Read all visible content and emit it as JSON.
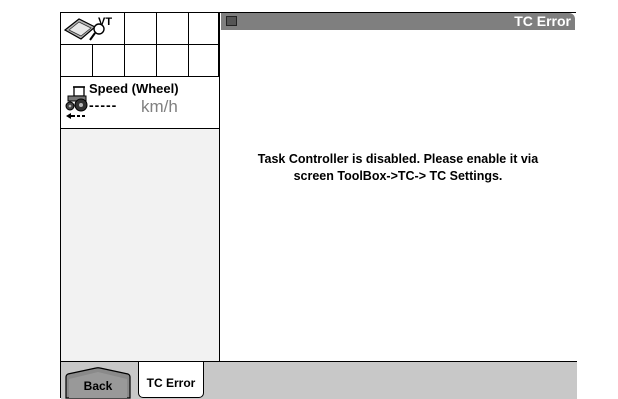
{
  "grid": {
    "vt_label": "VT"
  },
  "speed": {
    "title": "Speed (Wheel)",
    "value": "-----",
    "unit": "km/h"
  },
  "window": {
    "title": "TC Error"
  },
  "message": {
    "line1": "Task Controller is disabled. Please enable it via",
    "line2": "screen ToolBox->TC-> TC Settings."
  },
  "bottom": {
    "back_label": "Back",
    "tab_label": "TC Error"
  },
  "icons": {
    "vt": "vt-book-magnifier-icon",
    "tractor": "tractor-icon",
    "window": "window-icon"
  },
  "colors": {
    "title_bar": "#7f7f7f",
    "bottom_bar": "#c8c8c8",
    "unit_text": "#808080"
  }
}
